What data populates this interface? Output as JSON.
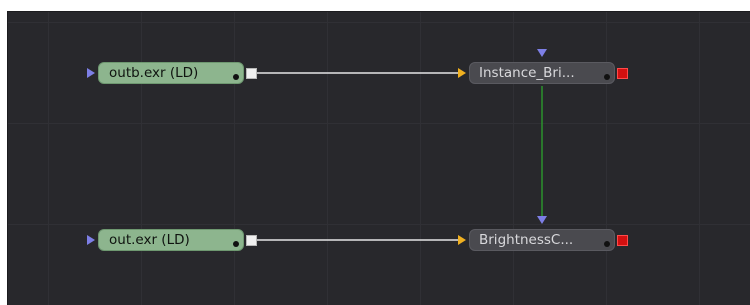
{
  "flow": {
    "nodes": {
      "loader_top": {
        "label": "outb.exr  (LD)",
        "icon": "loader-node"
      },
      "loader_bottom": {
        "label": "out.exr  (LD)",
        "icon": "loader-node"
      },
      "tool_top": {
        "label": "Instance_Bri...",
        "icon": "tool-node"
      },
      "tool_bottom": {
        "label": "BrightnessC...",
        "icon": "tool-node"
      }
    },
    "colors": {
      "canvas_bg": "#28282c",
      "grid_line": "#303035",
      "loader_node": "#8db58e",
      "tool_node": "#4a4a4f",
      "image_wire": "#e6e6e6",
      "instance_wire": "#2c9a2c",
      "input_port_blue": "#7d7fe6",
      "input_port_orange": "#f0b020",
      "output_port_white": "#f0f0f0",
      "output_port_red": "#d31010"
    }
  }
}
